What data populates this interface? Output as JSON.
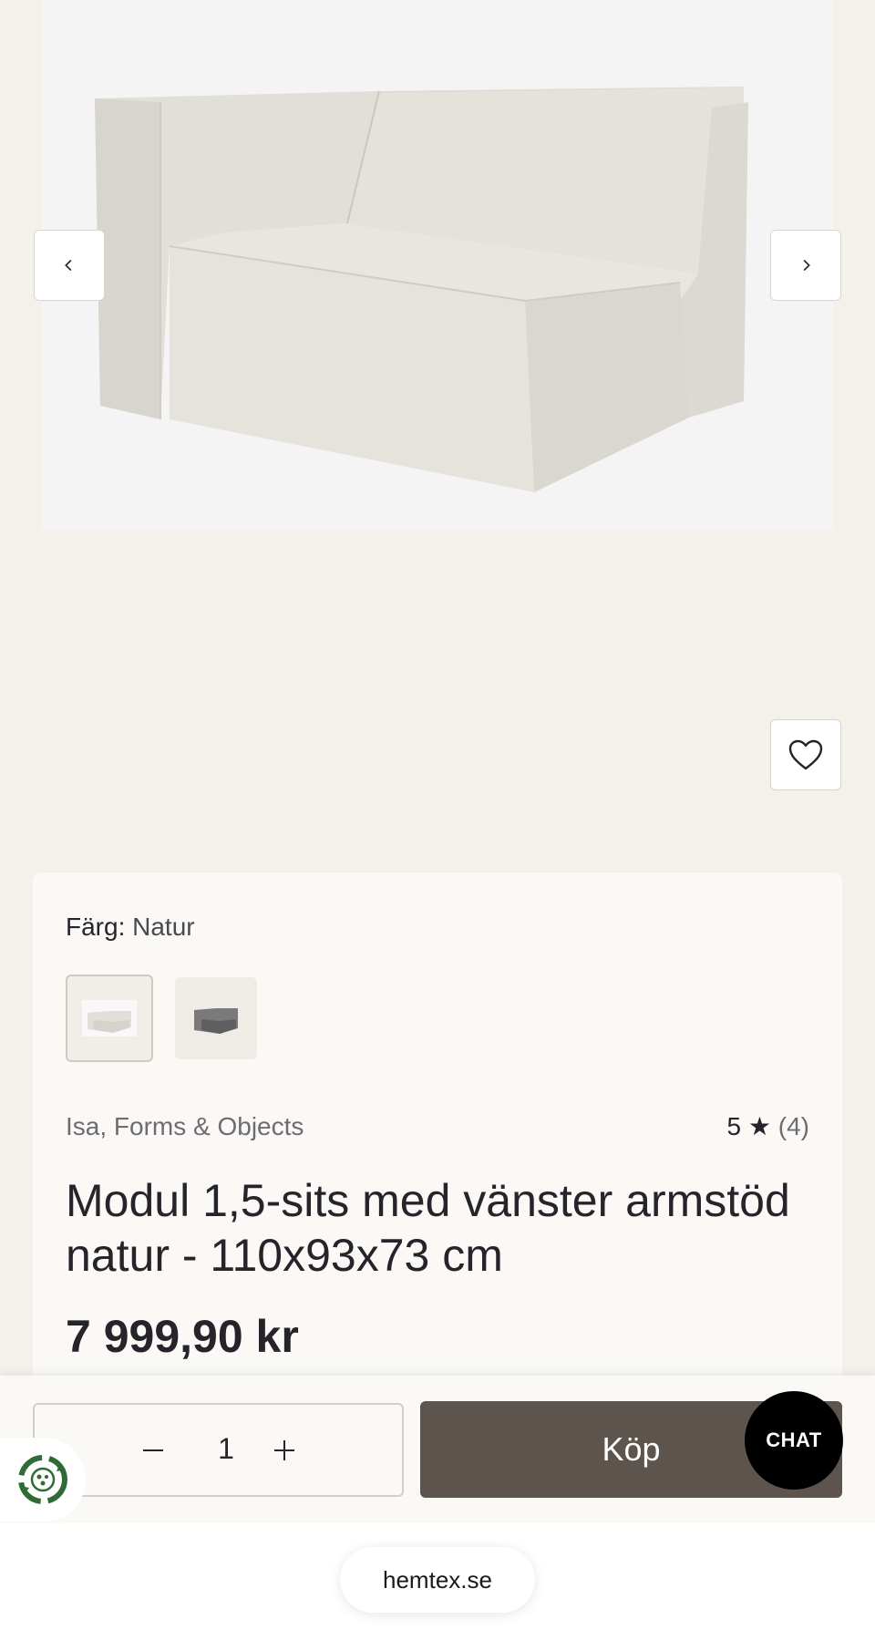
{
  "product": {
    "color_label": "Färg:",
    "color_value": "Natur",
    "swatches": [
      {
        "name": "Natur",
        "selected": true,
        "color": "#e7e4de"
      },
      {
        "name": "Grå",
        "selected": false,
        "color": "#6d6d6d"
      }
    ],
    "brand": "Isa, Forms & Objects",
    "rating_value": "5",
    "rating_star": "★",
    "rating_count": "(4)",
    "title": "Modul 1,5-sits med vänster armstöd natur - 110x93x73 cm",
    "price": "7 999,90 kr"
  },
  "gallery": {
    "prev_icon": "chevron-left-icon",
    "next_icon": "chevron-right-icon",
    "favorite_icon": "heart-icon"
  },
  "buy_bar": {
    "quantity": "1",
    "buy_label": "Köp"
  },
  "chat": {
    "label": "CHAT"
  },
  "eco_badge": {
    "icon": "recycle-icon"
  },
  "browser": {
    "url": "hemtex.se"
  },
  "colors": {
    "background": "#f4f1eb",
    "card": "#faf9f6",
    "buy_button": "#5d554d",
    "text": "#26242a",
    "muted": "#6e6c72",
    "eco_green": "#2e6b35"
  }
}
